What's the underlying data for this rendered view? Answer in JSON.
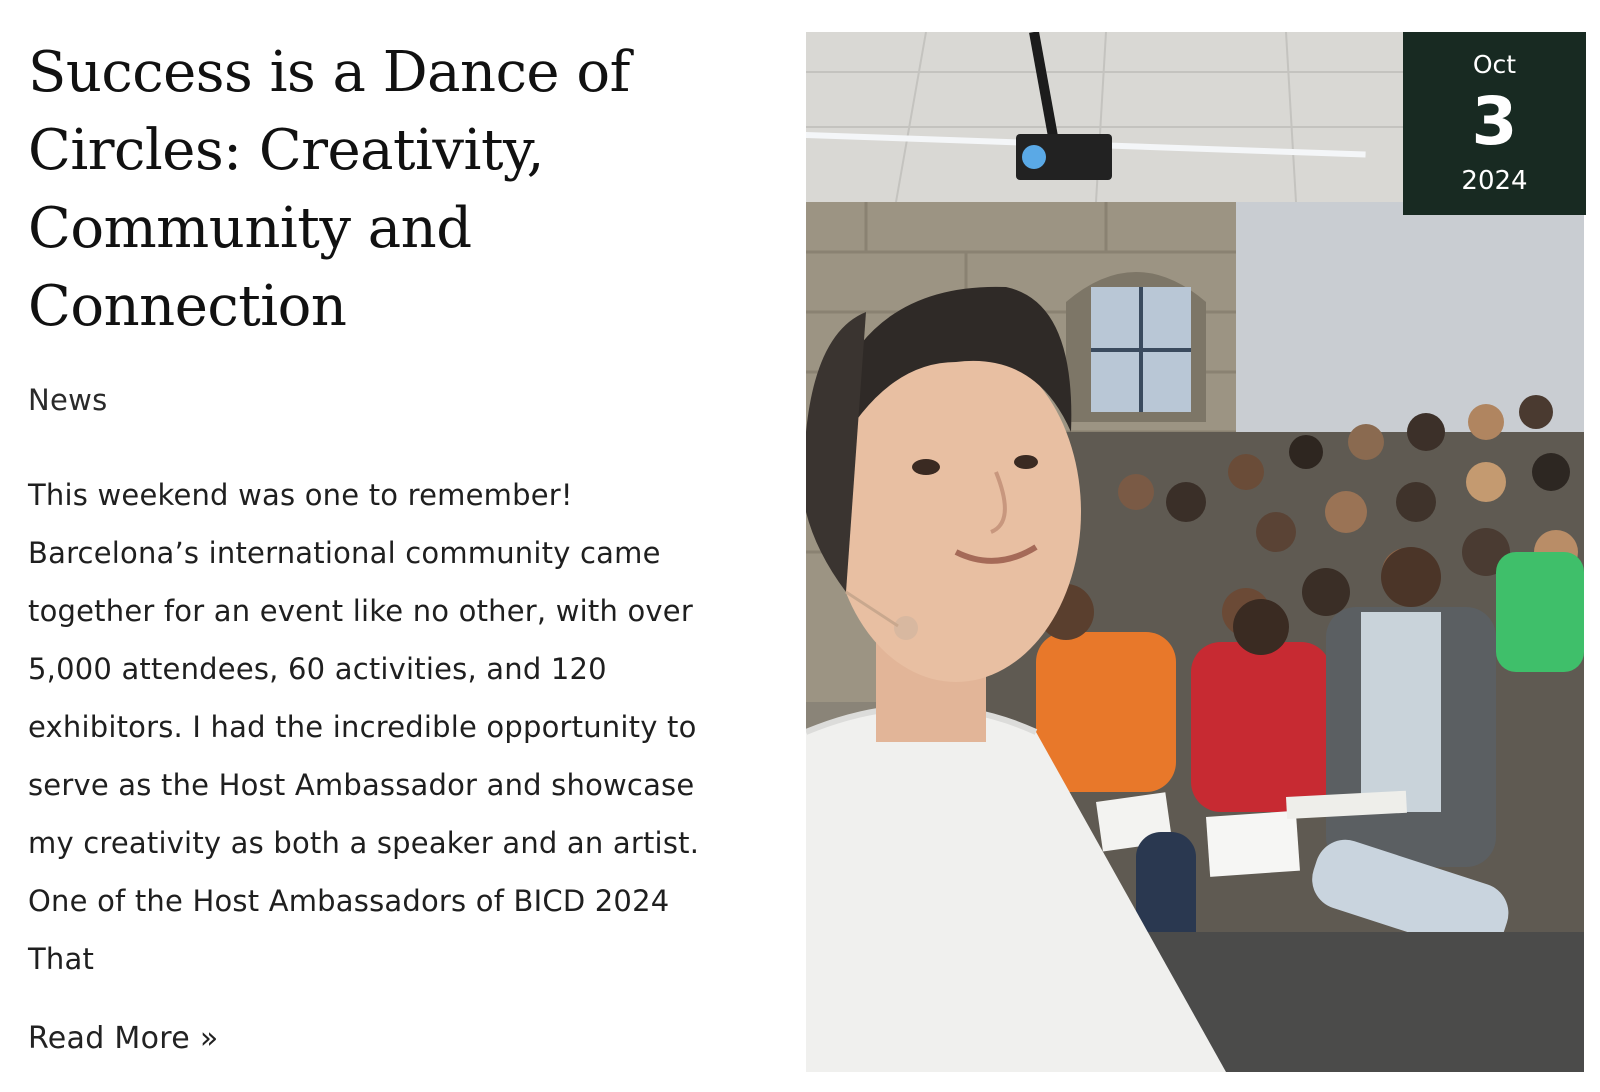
{
  "post": {
    "title": "Success is a Dance of Circles: Creativity, Community and Connection",
    "category": "News",
    "excerpt": "This weekend was one to remember! Barcelona’s international community came together for an event like no other, with over 5,000 attendees, 60 activities, and 120 exhibitors. I had the incredible opportunity to serve as the Host Ambassador and showcase my creativity as both a speaker and an artist. One of the Host Ambassadors of BICD 2024  That",
    "read_more": "Read More »",
    "date": {
      "month": "Oct",
      "day": "3",
      "year": "2024"
    },
    "image": {
      "alt": "Selfie of the speaker in front of a seated audience writing in notebooks"
    }
  },
  "colors": {
    "badge_background": "#182a22",
    "badge_text": "#ffffff",
    "title": "#111111",
    "body_text": "#1f1f1f"
  }
}
